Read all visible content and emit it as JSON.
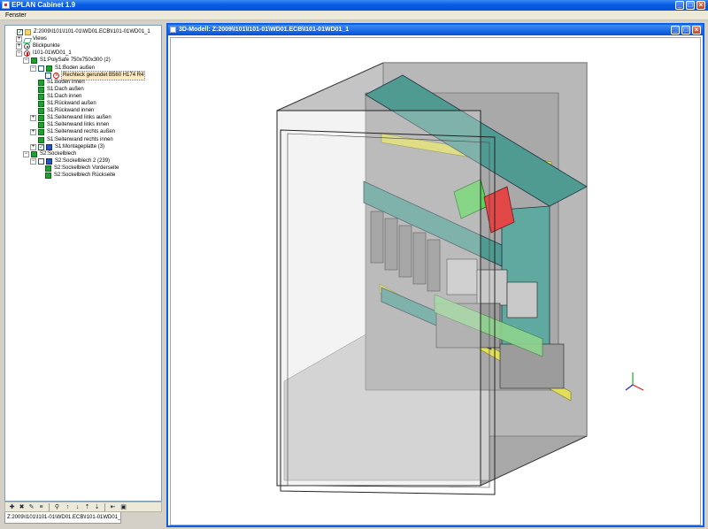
{
  "app": {
    "title": "EPLAN Cabinet 1.9"
  },
  "menu": {
    "items": [
      "Fenster"
    ]
  },
  "tree": {
    "rows": [
      {
        "label": "Z:2009\\I101\\I101-01\\WD01.ECB\\I101-01WD01_1",
        "expander": "",
        "icon": "project",
        "checked": true
      },
      {
        "label": "Views",
        "expander": "+",
        "icon": "views"
      },
      {
        "label": "Blickpunkte",
        "expander": "+",
        "icon": "eye"
      },
      {
        "label": "I101-01WD01_1",
        "expander": "−",
        "icon": "red"
      },
      {
        "label": "S1:PolySafe 750x750x300 (2)",
        "expander": "−",
        "icon": "green"
      },
      {
        "label": "S1:Boden außen",
        "expander": "−",
        "icon": "green",
        "checked": false
      },
      {
        "label": "Rechteck gerundet B560 H174 R4",
        "expander": "",
        "icon": "redcross",
        "checked": false,
        "selected": true
      },
      {
        "label": "S1:Boden innen",
        "expander": "",
        "icon": "green"
      },
      {
        "label": "S1:Dach außen",
        "expander": "",
        "icon": "green"
      },
      {
        "label": "S1:Dach innen",
        "expander": "",
        "icon": "green"
      },
      {
        "label": "S1:Rückwand außen",
        "expander": "",
        "icon": "green"
      },
      {
        "label": "S1:Rückwand innen",
        "expander": "",
        "icon": "green"
      },
      {
        "label": "S1:Seitenwand links außen",
        "expander": "+",
        "icon": "green"
      },
      {
        "label": "S1:Seitenwand links innen",
        "expander": "",
        "icon": "green"
      },
      {
        "label": "S1:Seitenwand rechts außen",
        "expander": "+",
        "icon": "green"
      },
      {
        "label": "S1:Seitenwand rechts innen",
        "expander": "",
        "icon": "green"
      },
      {
        "label": "S1:Montageplatte (3)",
        "expander": "+",
        "icon": "blue",
        "checked": true
      },
      {
        "label": "S2:Sockelblech",
        "expander": "−",
        "icon": "green"
      },
      {
        "label": "S2:Sockelblech 2 (239)",
        "expander": "−",
        "icon": "blue",
        "checked": false
      },
      {
        "label": "S2:Sockelblech Vorderseite",
        "expander": "",
        "icon": "green"
      },
      {
        "label": "S2:Sockelblech Rückseite",
        "expander": "",
        "icon": "green"
      }
    ]
  },
  "toolbar": {
    "buttons": [
      "add-icon",
      "remove-icon",
      "edit-icon",
      "find-icon",
      "arrow-up-icon",
      "arrow-down-icon",
      "move-up-icon",
      "move-down-icon",
      "collapse-icon",
      "view-icon"
    ]
  },
  "bottom_tab": {
    "label": "Z:2009\\I101\\I101-01\\WD01.ECB\\I101-01WD01_1"
  },
  "viewer": {
    "title": "3D-Modell: Z:2009\\I101\\I101-01\\WD01.ECB\\I101-01WD01_1",
    "axis_colors": {
      "x": "#d22",
      "y": "#2a2",
      "z": "#22d"
    }
  }
}
